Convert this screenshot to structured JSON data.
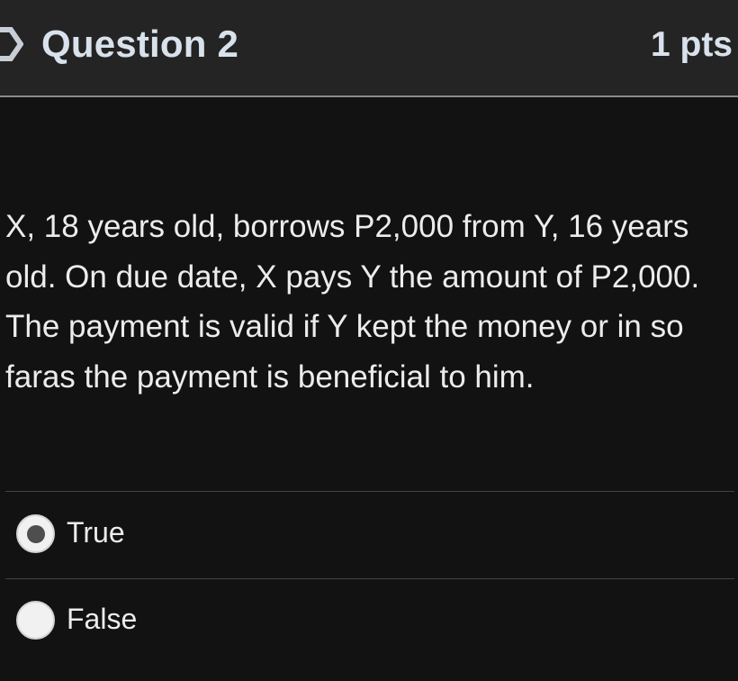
{
  "question": {
    "title": "Question 2",
    "points": "1 pts",
    "flag_icon": "flag-icon",
    "text": "X, 18 years old, borrows P2,000 from Y, 16 years old. On due date, X pays Y the amount of P2,000. The payment is valid if Y kept the money or in so faras the payment is beneficial to him."
  },
  "answers": [
    {
      "label": "True",
      "selected": true
    },
    {
      "label": "False",
      "selected": false
    }
  ],
  "colors": {
    "page_background": "#121212",
    "header_background": "#242424",
    "header_text": "#d9e2ec",
    "body_text": "#ececec",
    "divider": "#434343",
    "radio_fill": "#f1f1f1",
    "radio_dot": "#4e4e4e"
  }
}
